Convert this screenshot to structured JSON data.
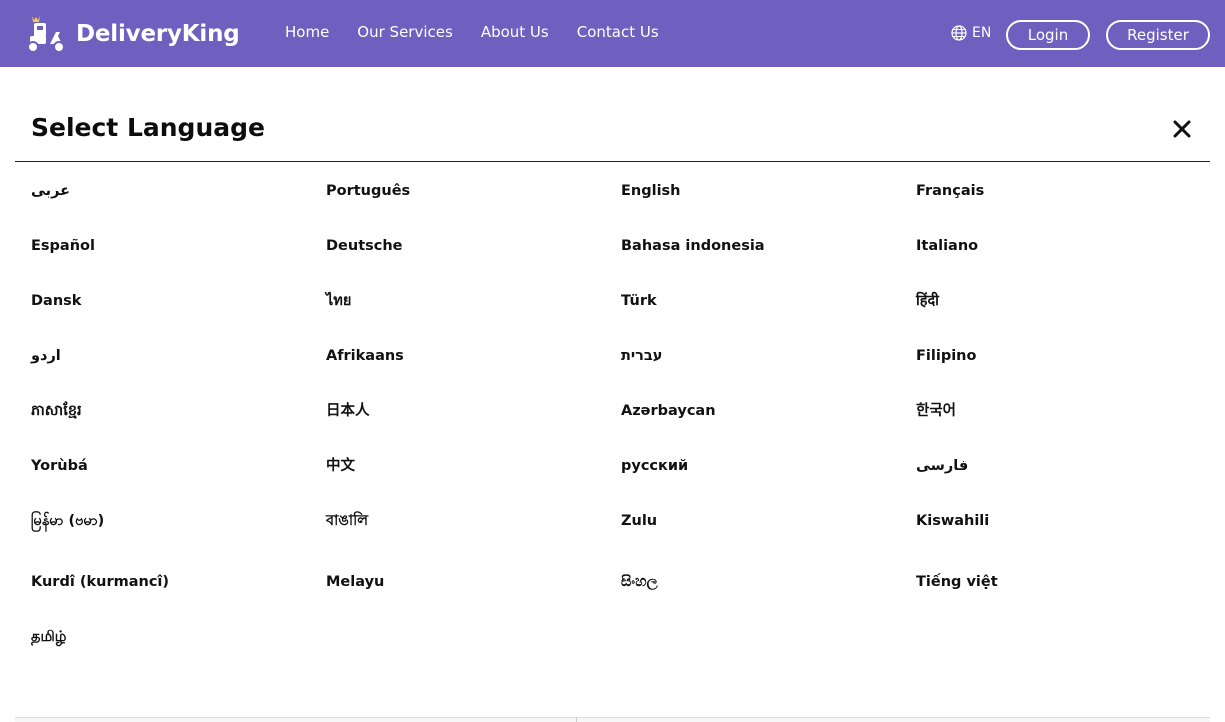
{
  "brand": {
    "name": "DeliveryKing"
  },
  "nav": {
    "links": [
      "Home",
      "Our Services",
      "About Us",
      "Contact Us"
    ],
    "language_code": "EN",
    "login_label": "Login",
    "register_label": "Register"
  },
  "modal": {
    "title": "Select Language",
    "languages": [
      [
        "عربى",
        "Português",
        "English",
        "Français"
      ],
      [
        "Español",
        "Deutsche",
        "Bahasa indonesia",
        "Italiano"
      ],
      [
        "Dansk",
        "ไทย",
        "Türk",
        "हिंदी"
      ],
      [
        "اردو",
        "Afrikaans",
        "עברית",
        "Filipino"
      ],
      [
        "ភាសាខ្មែរ",
        "日本人",
        "Azərbaycan",
        "한국어"
      ],
      [
        "Yorùbá",
        "中文",
        "русский",
        "فارسی"
      ],
      [
        "မြန်မာ (ဗမာ)",
        "বাঙালি",
        "Zulu",
        "Kiswahili"
      ],
      [
        "Kurdî (kurmancî)",
        "Melayu",
        "සිංහල",
        "Tiếng việt"
      ],
      [
        "தமிழ்"
      ]
    ]
  },
  "colors": {
    "navbar": "#6f5fbf",
    "text": "#111111"
  },
  "icons": {
    "language": "globe-icon",
    "close": "close-icon"
  }
}
